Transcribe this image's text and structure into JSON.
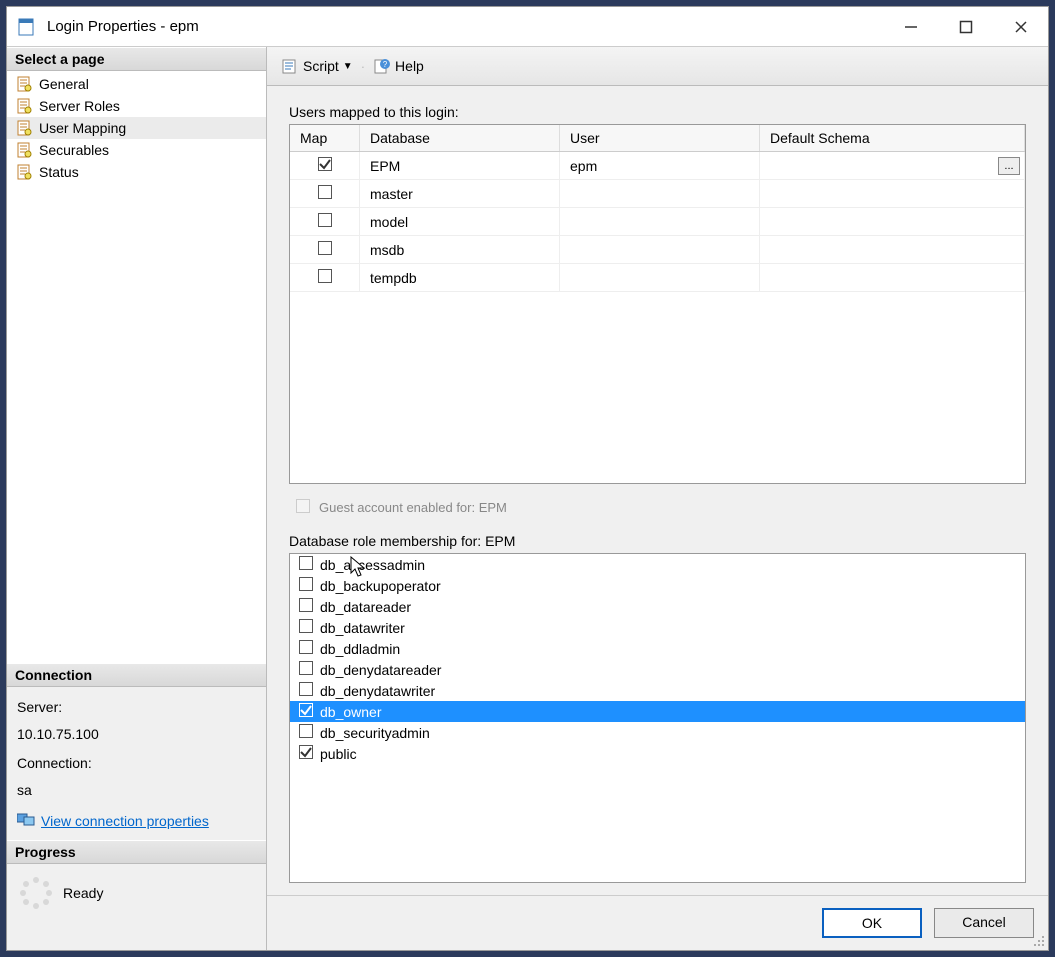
{
  "window": {
    "title": "Login Properties - epm"
  },
  "sidebar": {
    "select_page_header": "Select a page",
    "pages": [
      {
        "label": "General"
      },
      {
        "label": "Server Roles"
      },
      {
        "label": "User Mapping"
      },
      {
        "label": "Securables"
      },
      {
        "label": "Status"
      }
    ],
    "connection_header": "Connection",
    "server_label": "Server:",
    "server_value": "10.10.75.100",
    "connection_label": "Connection:",
    "connection_value": "sa",
    "view_conn_link": "View connection properties",
    "progress_header": "Progress",
    "progress_status": "Ready"
  },
  "toolbar": {
    "script_label": "Script",
    "help_label": "Help"
  },
  "mapping": {
    "label": "Users mapped to this login:",
    "columns": {
      "map": "Map",
      "database": "Database",
      "user": "User",
      "schema": "Default Schema"
    },
    "rows": [
      {
        "checked": true,
        "database": "EPM",
        "user": "epm",
        "schema": "",
        "show_ellipsis": true
      },
      {
        "checked": false,
        "database": "master",
        "user": "",
        "schema": ""
      },
      {
        "checked": false,
        "database": "model",
        "user": "",
        "schema": ""
      },
      {
        "checked": false,
        "database": "msdb",
        "user": "",
        "schema": ""
      },
      {
        "checked": false,
        "database": "tempdb",
        "user": "",
        "schema": ""
      }
    ],
    "guest_label": "Guest account enabled for: EPM",
    "roles_label": "Database role membership for: EPM",
    "roles": [
      {
        "name": "db_accessadmin",
        "checked": false,
        "selected": false
      },
      {
        "name": "db_backupoperator",
        "checked": false,
        "selected": false
      },
      {
        "name": "db_datareader",
        "checked": false,
        "selected": false
      },
      {
        "name": "db_datawriter",
        "checked": false,
        "selected": false
      },
      {
        "name": "db_ddladmin",
        "checked": false,
        "selected": false
      },
      {
        "name": "db_denydatareader",
        "checked": false,
        "selected": false
      },
      {
        "name": "db_denydatawriter",
        "checked": false,
        "selected": false
      },
      {
        "name": "db_owner",
        "checked": true,
        "selected": true
      },
      {
        "name": "db_securityadmin",
        "checked": false,
        "selected": false
      },
      {
        "name": "public",
        "checked": true,
        "selected": false
      }
    ]
  },
  "footer": {
    "ok": "OK",
    "cancel": "Cancel"
  }
}
